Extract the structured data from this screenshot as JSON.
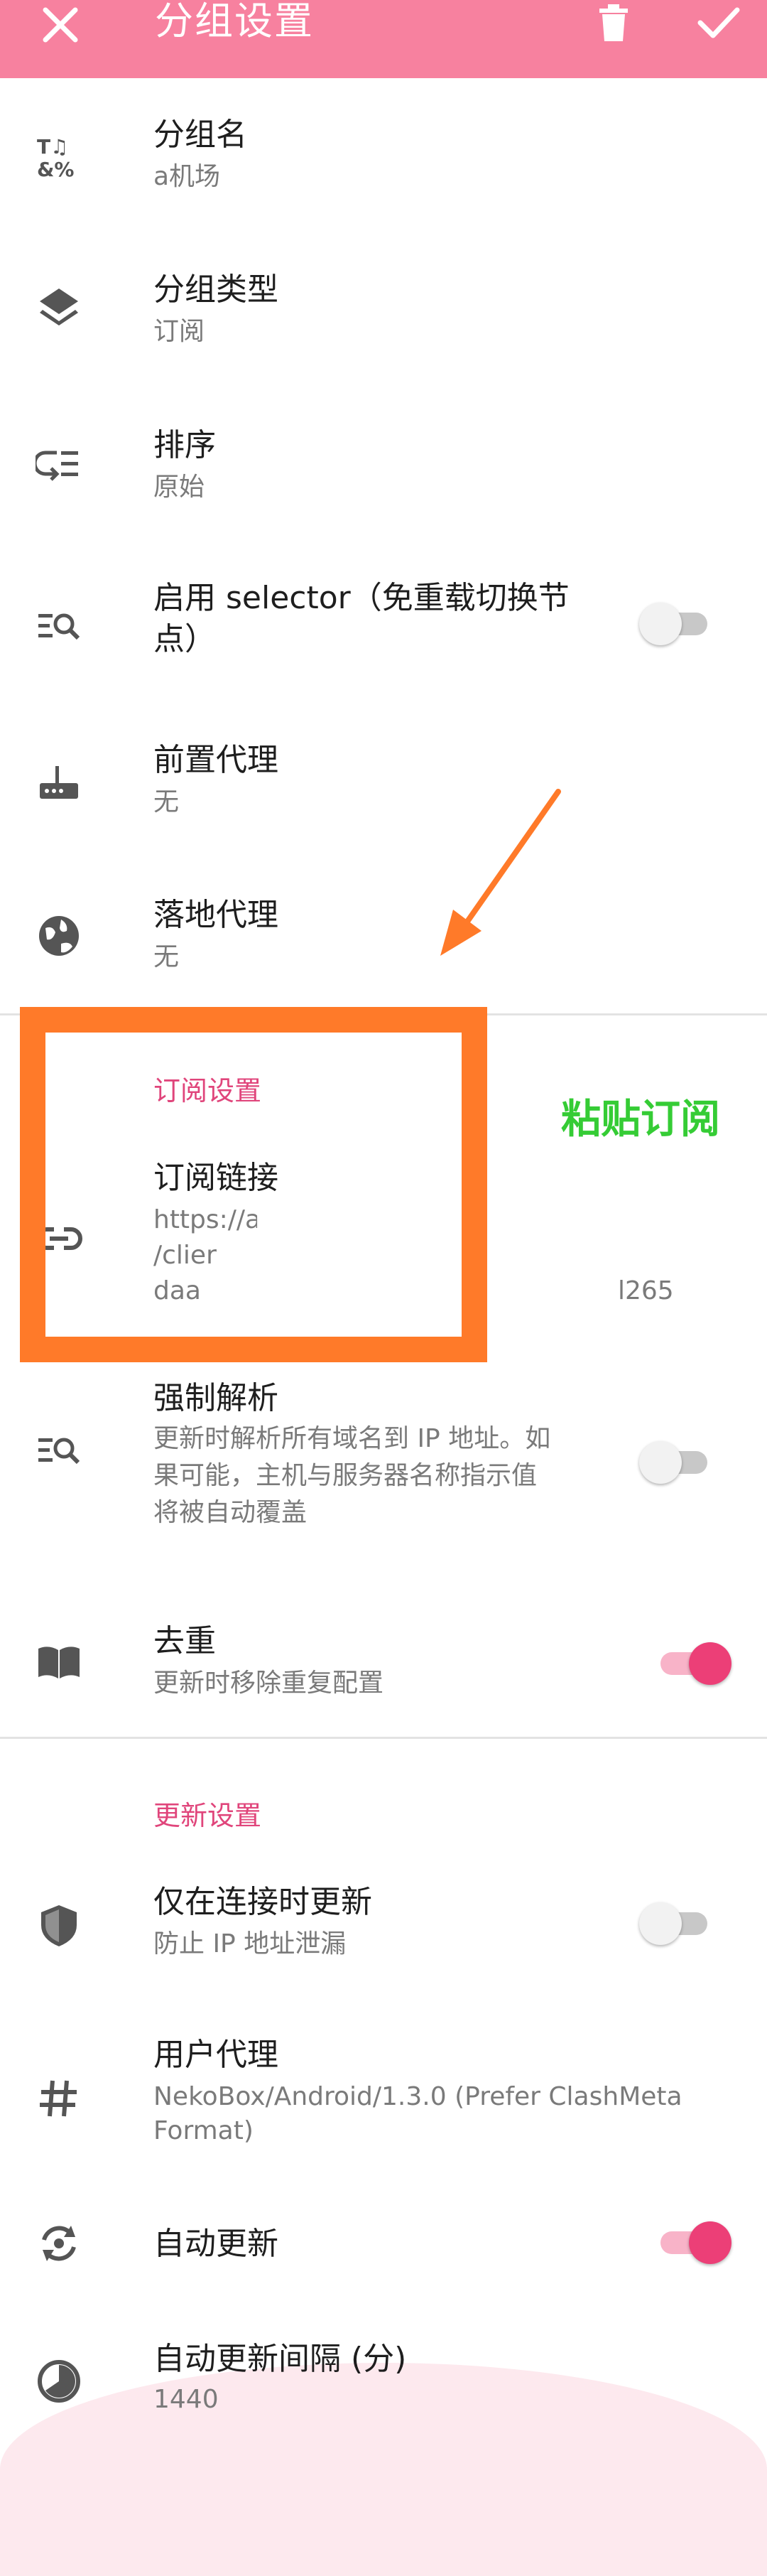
{
  "colors": {
    "appbar": "#f7819f",
    "accent": "#e0457b",
    "annotation_box": "#ff7a29",
    "annotation_text": "#35cc35"
  },
  "appbar": {
    "title": "分组设置",
    "close_icon": "close-icon",
    "delete_icon": "trash-icon",
    "confirm_icon": "check-icon"
  },
  "items": {
    "group_name": {
      "title": "分组名",
      "subtitle": "a机场",
      "icon": "text-format-icon"
    },
    "group_type": {
      "title": "分组类型",
      "subtitle": "订阅",
      "icon": "layers-icon"
    },
    "sort": {
      "title": "排序",
      "subtitle": "原始",
      "icon": "sort-icon"
    },
    "selector": {
      "title": "启用 selector（免重载切换节",
      "title2": "点）",
      "icon": "search-list-icon",
      "enabled": false
    },
    "front_proxy": {
      "title": "前置代理",
      "subtitle": "无",
      "icon": "router-icon"
    },
    "landing_proxy": {
      "title": "落地代理",
      "subtitle": "无",
      "icon": "globe-icon"
    },
    "subscription_link": {
      "title": "订阅链接",
      "line1": "https://a",
      "line2": "/clier",
      "line3": "daa",
      "tail": "l265",
      "icon": "link-icon"
    },
    "force_resolve": {
      "title": "强制解析",
      "desc1": "更新时解析所有域名到 IP 地址。如",
      "desc2": "果可能，主机与服务器名称指示值",
      "desc3": "将被自动覆盖",
      "icon": "search-list-icon",
      "enabled": false
    },
    "dedup": {
      "title": "去重",
      "subtitle": "更新时移除重复配置",
      "icon": "book-icon",
      "enabled": true
    },
    "update_when_connected": {
      "title": "仅在连接时更新",
      "subtitle": "防止 IP 地址泄漏",
      "icon": "shield-icon",
      "enabled": false
    },
    "user_agent": {
      "title": "用户代理",
      "line1": "NekoBox/Android/1.3.0 (Prefer ClashMeta",
      "line2": "Format)",
      "icon": "hash-icon"
    },
    "auto_update": {
      "title": "自动更新",
      "icon": "sync-icon",
      "enabled": true
    },
    "auto_update_interval": {
      "title": "自动更新间隔 (分)",
      "subtitle": "1440",
      "icon": "timer-icon"
    }
  },
  "sections": {
    "subscription": "订阅设置",
    "update": "更新设置"
  },
  "annotation": {
    "label": "粘贴订阅"
  }
}
